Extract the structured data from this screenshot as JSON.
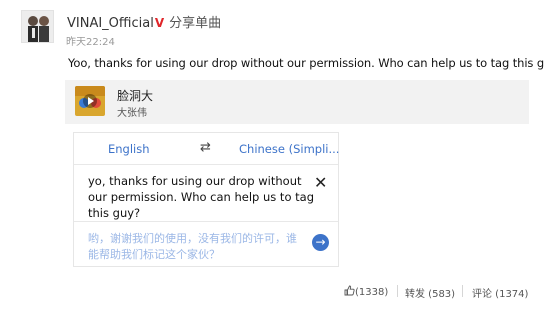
{
  "post": {
    "username": "VINAI_Official",
    "verified_badge": "V",
    "share_label": "分享单曲",
    "timestamp": "昨天22:24",
    "text": "Yoo, thanks for using our drop without our permission. Who can help us to tag this guy?"
  },
  "music_card": {
    "title": "脸洞大",
    "artist": "大张伟",
    "play_icon": "play-icon"
  },
  "translate": {
    "source_lang": "English",
    "target_lang": "Chinese (Simpli...",
    "swap_icon": "swap-arrows-icon",
    "source_text": "yo, thanks for using our drop without our permission. Who can help us to tag this guy?",
    "target_text": "哟，谢谢我们的使用，没有我们的许可，谁能帮助我们标记这个家伙？",
    "accent_color": "#3d73c9"
  },
  "actions": {
    "like_count": "(1338)",
    "repost_label": "转发 (583)",
    "comment_label": "评论 (1374)"
  }
}
